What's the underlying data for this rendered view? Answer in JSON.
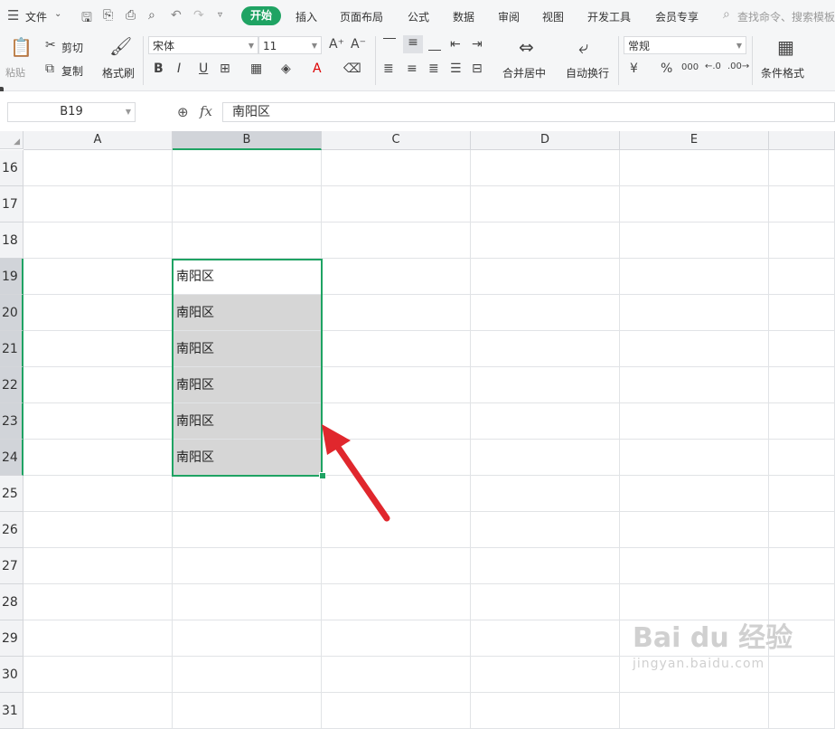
{
  "menu": {
    "file_label": "文件",
    "tabs": [
      "开始",
      "插入",
      "页面布局",
      "公式",
      "数据",
      "审阅",
      "视图",
      "开发工具",
      "会员专享"
    ],
    "search_placeholder": "查找命令、搜索模板"
  },
  "ribbon": {
    "paste_label": "粘贴",
    "cut_label": "剪切",
    "copy_label": "复制",
    "format_painter_label": "格式刷",
    "font_name": "宋体",
    "font_size": "11",
    "merge_center_label": "合并居中",
    "wrap_text_label": "自动换行",
    "number_format": "常规",
    "conditional_format_label": "条件格式",
    "currency_symbol": "¥",
    "percent_symbol": "%",
    "thousands_symbol": "000"
  },
  "formula_bar": {
    "name_box": "B19",
    "fx_label": "fx",
    "value": "南阳区"
  },
  "sheet": {
    "columns": [
      "A",
      "B",
      "C",
      "D",
      "E"
    ],
    "selected_column": "B",
    "rows": [
      "16",
      "17",
      "18",
      "19",
      "20",
      "21",
      "22",
      "23",
      "24",
      "25",
      "26",
      "27",
      "28",
      "29",
      "30",
      "31"
    ],
    "selected_rows": [
      "19",
      "20",
      "21",
      "22",
      "23",
      "24"
    ],
    "cells_b": [
      "",
      "",
      "",
      "南阳区",
      "南阳区",
      "南阳区",
      "南阳区",
      "南阳区",
      "南阳区",
      "",
      "",
      "",
      "",
      "",
      "",
      ""
    ]
  },
  "watermark": {
    "brand": "Bai du 经验",
    "url": "jingyan.baidu.com"
  },
  "colors": {
    "accent": "#1fa363",
    "arrow": "#e0272d",
    "selection_fill": "#d6d6d6"
  }
}
